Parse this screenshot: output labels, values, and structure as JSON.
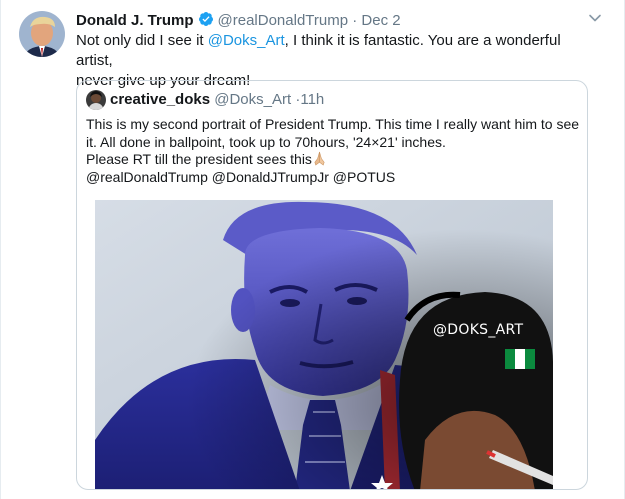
{
  "tweet": {
    "author_name": "Donald J. Trump",
    "author_handle": "@realDonaldTrump",
    "separator": "·",
    "date": "Dec 2",
    "text_part1": "Not only did I see it ",
    "mention": "@Doks_Art",
    "text_part2": ", I think it is fantastic. You are a wonderful artist,",
    "text_part3": "never give up your dream!"
  },
  "quote": {
    "author_name": "creative_doks",
    "author_handle": "@Doks_Art",
    "separator": "·",
    "time": "11h",
    "lines": [
      "This is my second portrait of President Trump. This time I really want him to see",
      "it. All done in ballpoint, took up to 70hours, '24×21' inches.",
      "Please RT till the president sees this"
    ],
    "mentions_line": "@realDonaldTrump @DonaldJTrumpJr @POTUS",
    "media": {
      "watermark": "@DOKS_ART",
      "flag_icon": "nigeria-flag-icon"
    }
  },
  "colors": {
    "link": "#1b95e0",
    "secondary_text": "#657786",
    "verified": "#1da1f2",
    "border": "#ccd6dd"
  }
}
